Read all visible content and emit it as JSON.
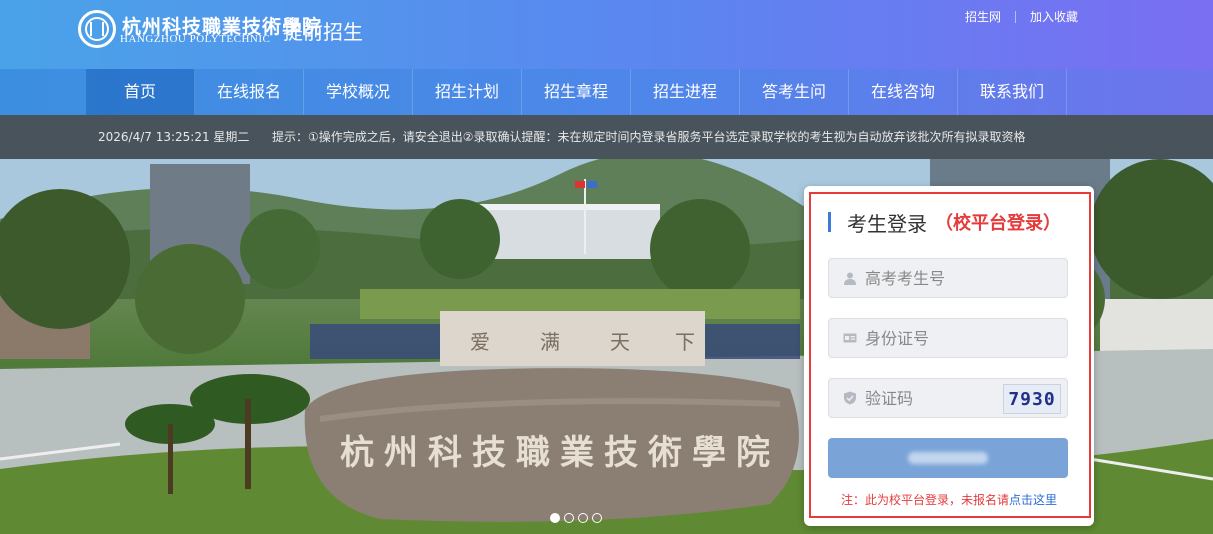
{
  "header": {
    "school_cn": "杭州科技職業技術學院",
    "school_en": "HANGZHOU POLYTECHNIC",
    "app_title": "提前招生",
    "links": [
      "招生网",
      "加入收藏"
    ]
  },
  "nav": {
    "items": [
      "首页",
      "在线报名",
      "学校概况",
      "招生计划",
      "招生章程",
      "招生进程",
      "答考生问",
      "在线咨询",
      "联系我们"
    ],
    "active_index": 0
  },
  "notice": {
    "datetime": "2026/4/7 13:25:21 星期二",
    "message": "提示：①操作完成之后，请安全退出②录取确认提醒：未在规定时间内登录省服务平台选定录取学校的考生视为自动放弃该批次所有拟录取资格"
  },
  "banner": {
    "stone_text": "杭州科技職業技術學院",
    "wall_text": [
      "爱",
      "满",
      "天",
      "下"
    ],
    "slides": 4,
    "active_slide": 0
  },
  "login": {
    "title": "考生登录",
    "subtitle": "（校平台登录）",
    "exam_id_placeholder": "高考考生号",
    "id_card_placeholder": "身份证号",
    "captcha_placeholder": "验证码",
    "captcha_value": "7930",
    "note_prefix": "注：此为校平台登录，未报名请",
    "note_link": "点击这里"
  },
  "colors": {
    "accent": "#3b7bd8",
    "alert_red": "#e53b3b",
    "button": "#7aa4d8"
  }
}
